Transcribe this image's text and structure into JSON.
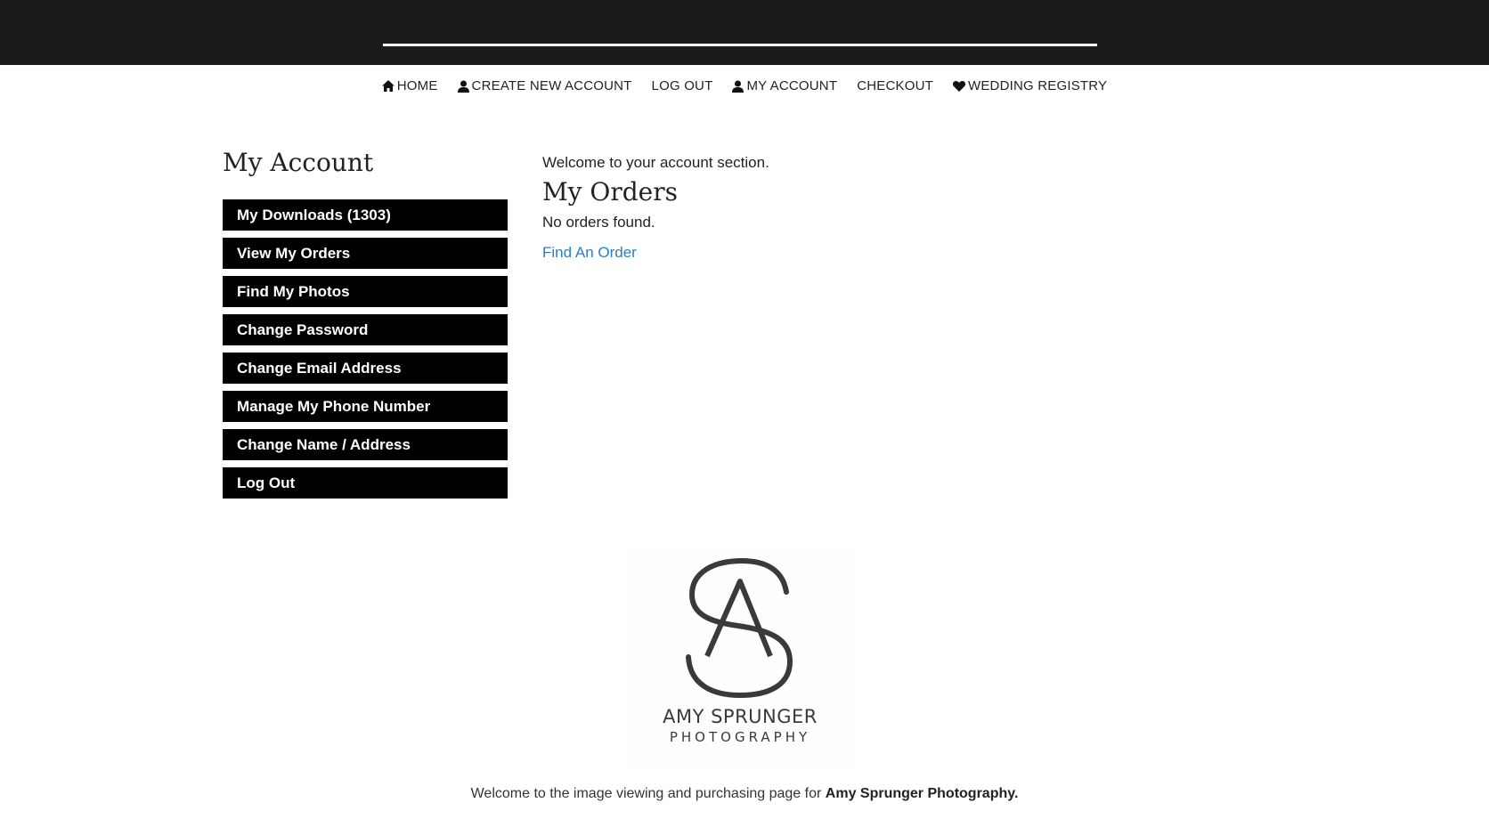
{
  "nav": {
    "items": [
      {
        "label": "HOME",
        "icon": "home-icon"
      },
      {
        "label": "CREATE NEW ACCOUNT",
        "icon": "user-icon"
      },
      {
        "label": "LOG OUT",
        "icon": ""
      },
      {
        "label": "MY ACCOUNT",
        "icon": "user-icon"
      },
      {
        "label": "CHECKOUT",
        "icon": ""
      },
      {
        "label": "WEDDING REGISTRY",
        "icon": "heart-icon"
      }
    ]
  },
  "sidebar": {
    "title": "My Account",
    "items": [
      {
        "label": "My Downloads (1303)"
      },
      {
        "label": "View My Orders"
      },
      {
        "label": "Find My Photos"
      },
      {
        "label": "Change Password"
      },
      {
        "label": "Change Email Address"
      },
      {
        "label": "Manage My Phone Number"
      },
      {
        "label": "Change Name / Address"
      },
      {
        "label": "Log Out"
      }
    ]
  },
  "main": {
    "welcome": "Welcome to your account section.",
    "orders_heading": "My Orders",
    "no_orders": "No orders found.",
    "find_order_link": "Find An Order"
  },
  "logo": {
    "name": "AMY SPRUNGER",
    "sub": "PHOTOGRAPHY"
  },
  "footer": {
    "text": "Welcome to the image viewing and purchasing page for",
    "brand": "Amy Sprunger Photography."
  },
  "colors": {
    "topbar": "#1b1b1b",
    "button_bg": "#000000",
    "link": "#2a7fc1"
  }
}
